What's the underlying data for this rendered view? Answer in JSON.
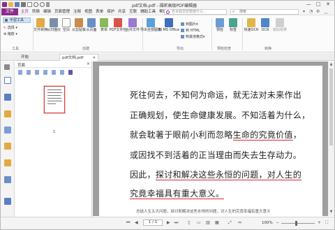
{
  "title": "pdf文档.pdf - 福昕高级PDF编辑器",
  "menu": {
    "file": "文件",
    "tabs": [
      "主页",
      "转换",
      "编辑",
      "页面管理",
      "注释",
      "视图",
      "表单",
      "保护",
      "共享",
      "互联",
      "辅助工具",
      "帮助"
    ],
    "tell_me": "告诉我您想要做什么...",
    "search_placeholder": "搜索"
  },
  "ribbon": {
    "hand_tool": "手型工具",
    "select_tool": "选择",
    "zoom_tool": "缩放",
    "group_tools": "工具",
    "btn_file_convert": "文件转换",
    "btn_scanner": "从扫描仪",
    "btn_blank": "空白",
    "btn_from_clip": "从剪贴板",
    "btn_from_page": "从页面",
    "btn_form": "表单",
    "btn_pdf_file": "PDF文件包",
    "btn_merge": "合并文件",
    "group_create": "创建",
    "btn_export_all": "导出全部图像",
    "btn_to_office": "到 MS Office",
    "btn_to_image": "到图片",
    "btn_to_html": "到 HTML",
    "btn_other": "到其他格式",
    "group_export": "导出",
    "btn_preflight": "预检",
    "btn_mark": "标签",
    "group_preflight": "预检检查",
    "btn_fast_ocr": "快速OCR",
    "btn_ocr": "OCR",
    "btn_suspect": "疑似结果",
    "group_convert": "转换"
  },
  "doc_tabs": [
    "开始",
    "pdf文档.pdf"
  ],
  "panel": {
    "title": "页面",
    "page_number": "1"
  },
  "document": {
    "lines": [
      "死往何去，不知何为命运，就无法对未来作出",
      "正确规划，使生命健康发展。不知活着为什么，",
      "就会耽著于眼前小利而忽略生命的究竟价值，",
      "或因找不到活着的正当理由而失去生存动力。",
      "因此，探讨和解决这些永恒的问题，对人生的",
      "究竟幸福具有重大意义。"
    ],
    "caption": "总结人生五大问题，探讨和解决这些永恒的问题，对人生的究竟幸福有重大意义"
  },
  "status": {
    "page": "1 / 1",
    "zoom": "100%"
  }
}
